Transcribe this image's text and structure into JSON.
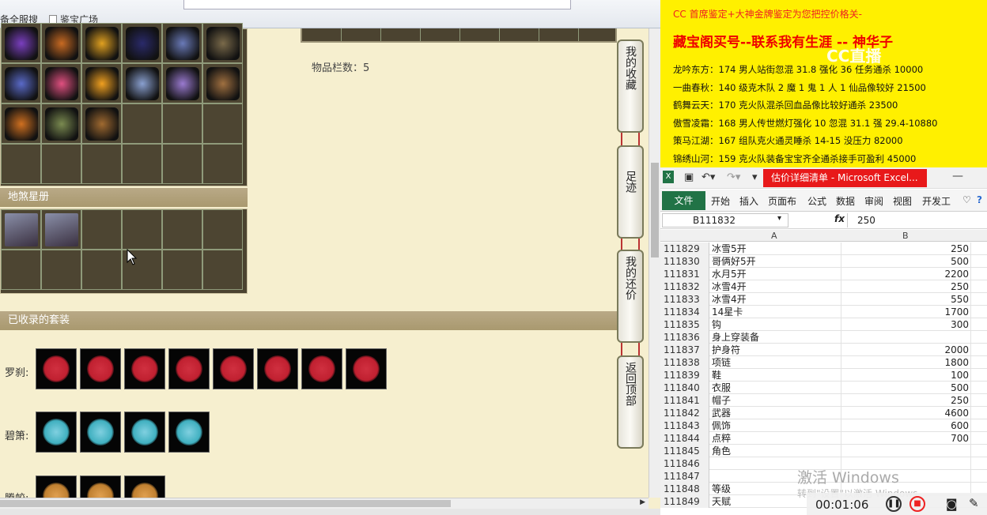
{
  "browser": {
    "bookmarks": [
      "备全服搜",
      "鉴宝广场"
    ]
  },
  "game": {
    "item_count_label": "物品栏数：5",
    "star_section_title": "地煞星册",
    "suits_section_title": "已收录的套装",
    "suits": [
      {
        "name": "罗刹:",
        "count": 8
      },
      {
        "name": "碧箫:",
        "count": 4
      },
      {
        "name": "腾蛟:",
        "count": 3
      }
    ],
    "side_buttons": [
      "我的收藏",
      "足迹",
      "我的还价",
      "返回顶部"
    ]
  },
  "note": {
    "line1": "CC 首席鉴定+大神金牌鉴定为您把控价格关-",
    "line2": "藏宝阁买号--联系我有生涯 -- 神华子",
    "overlay_logo": "CC直播",
    "rows": [
      "龙吟东方：174 男人站街忽混 31.8 强化 36 任务通杀 10000",
      "一曲春秋：140 级克木队 2 魔 1 鬼 1 人 1 仙品像较好 21500",
      "鹤舞云天：170 克火队混杀回血品像比较好通杀 23500",
      "傲雪凌霜：168 男人传世燃灯强化 10 忽混 31.1 强 29.4-10880",
      "策马江湖：167 组队克火通灵睡杀 14-15 没压力 82000",
      "锦绣山河：159 克火队装备宝宝齐全通杀接手可盈利 45000"
    ]
  },
  "excel": {
    "title": "估价详细清单 - Microsoft Excel...",
    "tabs": [
      "文件",
      "开始",
      "插入",
      "页面布",
      "公式",
      "数据",
      "审阅",
      "视图",
      "开发工"
    ],
    "name_box": "B111832",
    "formula_value": "250",
    "col_headers": [
      "A",
      "B"
    ],
    "rows": [
      {
        "n": "111829",
        "a": "冰雪5开",
        "b": "250"
      },
      {
        "n": "111830",
        "a": "哥俩好5开",
        "b": "500"
      },
      {
        "n": "111831",
        "a": "水月5开",
        "b": "2200"
      },
      {
        "n": "111832",
        "a": "冰雪4开",
        "b": "250"
      },
      {
        "n": "111833",
        "a": "冰雪4开",
        "b": "550"
      },
      {
        "n": "111834",
        "a": "14星卡",
        "b": "1700"
      },
      {
        "n": "111835",
        "a": "钩",
        "b": "300"
      },
      {
        "n": "111836",
        "a": "身上穿装备",
        "b": ""
      },
      {
        "n": "111837",
        "a": "护身符",
        "b": "2000"
      },
      {
        "n": "111838",
        "a": "项链",
        "b": "1800"
      },
      {
        "n": "111839",
        "a": "鞋",
        "b": "100"
      },
      {
        "n": "111840",
        "a": "衣服",
        "b": "500"
      },
      {
        "n": "111841",
        "a": "帽子",
        "b": "250"
      },
      {
        "n": "111842",
        "a": "武器",
        "b": "4600"
      },
      {
        "n": "111843",
        "a": "佩饰",
        "b": "600"
      },
      {
        "n": "111844",
        "a": "点粹",
        "b": "700"
      },
      {
        "n": "111845",
        "a": "角色",
        "b": ""
      },
      {
        "n": "111846",
        "a": "",
        "b": ""
      },
      {
        "n": "111847",
        "a": "",
        "b": ""
      },
      {
        "n": "111848",
        "a": "等级",
        "b": ""
      },
      {
        "n": "111849",
        "a": "天赋",
        "b": ""
      }
    ]
  },
  "windows": {
    "activate_title": "激活 Windows",
    "activate_sub": "转到\"设置\"以激活 Windows。"
  },
  "recorder": {
    "time": "00:01:06"
  },
  "colors": {
    "note_bg": "#fff000",
    "excel_green": "#217346",
    "title_red": "#e8191a"
  }
}
